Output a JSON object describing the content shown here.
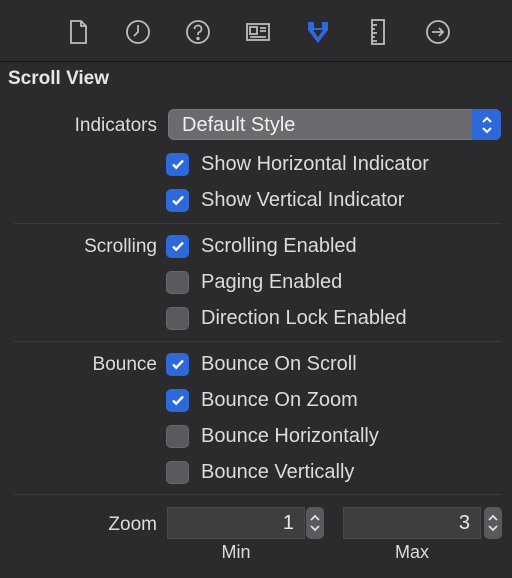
{
  "toolbar": {
    "icons": [
      "file-icon",
      "clock-icon",
      "help-icon",
      "identity-icon",
      "attributes-icon",
      "ruler-icon",
      "connections-icon"
    ],
    "active": "attributes-icon",
    "accent": "#2e68d9"
  },
  "section": {
    "title": "Scroll View"
  },
  "indicators": {
    "label": "Indicators",
    "popup_value": "Default Style",
    "show_horizontal": {
      "label": "Show Horizontal Indicator",
      "checked": true
    },
    "show_vertical": {
      "label": "Show Vertical Indicator",
      "checked": true
    }
  },
  "scrolling": {
    "label": "Scrolling",
    "enabled": {
      "label": "Scrolling Enabled",
      "checked": true
    },
    "paging": {
      "label": "Paging Enabled",
      "checked": false
    },
    "direction_lock": {
      "label": "Direction Lock Enabled",
      "checked": false
    }
  },
  "bounce": {
    "label": "Bounce",
    "on_scroll": {
      "label": "Bounce On Scroll",
      "checked": true
    },
    "on_zoom": {
      "label": "Bounce On Zoom",
      "checked": true
    },
    "horizontally": {
      "label": "Bounce Horizontally",
      "checked": false
    },
    "vertically": {
      "label": "Bounce Vertically",
      "checked": false
    }
  },
  "zoom": {
    "label": "Zoom",
    "min_value": "1",
    "max_value": "3",
    "min_label": "Min",
    "max_label": "Max"
  }
}
